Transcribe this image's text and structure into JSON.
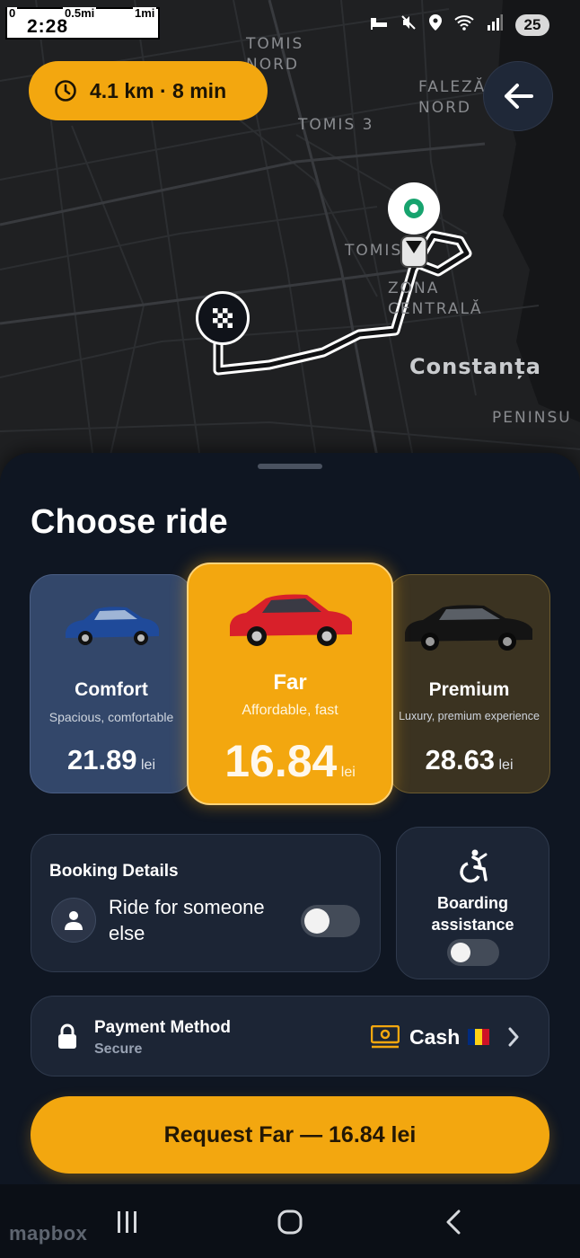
{
  "status_bar": {
    "time": "2:28",
    "scale_labels": [
      "0",
      "0.5mi",
      "1mi"
    ],
    "battery": "25",
    "icons": [
      "bed-icon",
      "mute-icon",
      "location-icon",
      "wifi-icon",
      "signal-icon"
    ]
  },
  "map": {
    "labels": [
      {
        "id": "tomis-nord",
        "text": "TOMIS\nNORD"
      },
      {
        "id": "faleza-nord",
        "text": "FALEZĂ\nNORD"
      },
      {
        "id": "tomis-3",
        "text": "TOMIS 3"
      },
      {
        "id": "tomis",
        "text": "TOMIS"
      },
      {
        "id": "zona-centrala",
        "text": "ZONA\nCENTRALĂ"
      },
      {
        "id": "peninsula",
        "text": "PENINSU"
      }
    ],
    "city": "Constanța",
    "attribution": "mapbox"
  },
  "eta": {
    "text": "4.1 km · 8 min",
    "icon": "clock-icon"
  },
  "sheet": {
    "title": "Choose ride",
    "rides": [
      {
        "id": "comfort",
        "name": "Comfort",
        "subtitle": "Spacious, comfortable",
        "price": "21.89",
        "unit": "lei",
        "car_color": "#1f4a9a"
      },
      {
        "id": "far",
        "name": "Far",
        "subtitle": "Affordable, fast",
        "price": "16.84",
        "unit": "lei",
        "car_color": "#d8202a",
        "selected": true
      },
      {
        "id": "premium",
        "name": "Premium",
        "subtitle": "Luxury, premium experience",
        "price": "28.63",
        "unit": "lei",
        "car_color": "#141414"
      }
    ],
    "booking": {
      "title": "Booking Details",
      "option_label": "Ride for someone else",
      "toggle_on": false
    },
    "boarding": {
      "label": "Boarding assistance",
      "toggle_on": false
    },
    "payment": {
      "title": "Payment Method",
      "subtitle": "Secure",
      "method": "Cash",
      "flag": "🇷🇴"
    },
    "request_button": "Request Far — 16.84 lei"
  },
  "colors": {
    "accent": "#f3a70f",
    "sheet_bg": "#0f1622",
    "panel_bg": "#1c2535",
    "comfort_card": "#33476a",
    "premium_card": "#3b3321"
  }
}
